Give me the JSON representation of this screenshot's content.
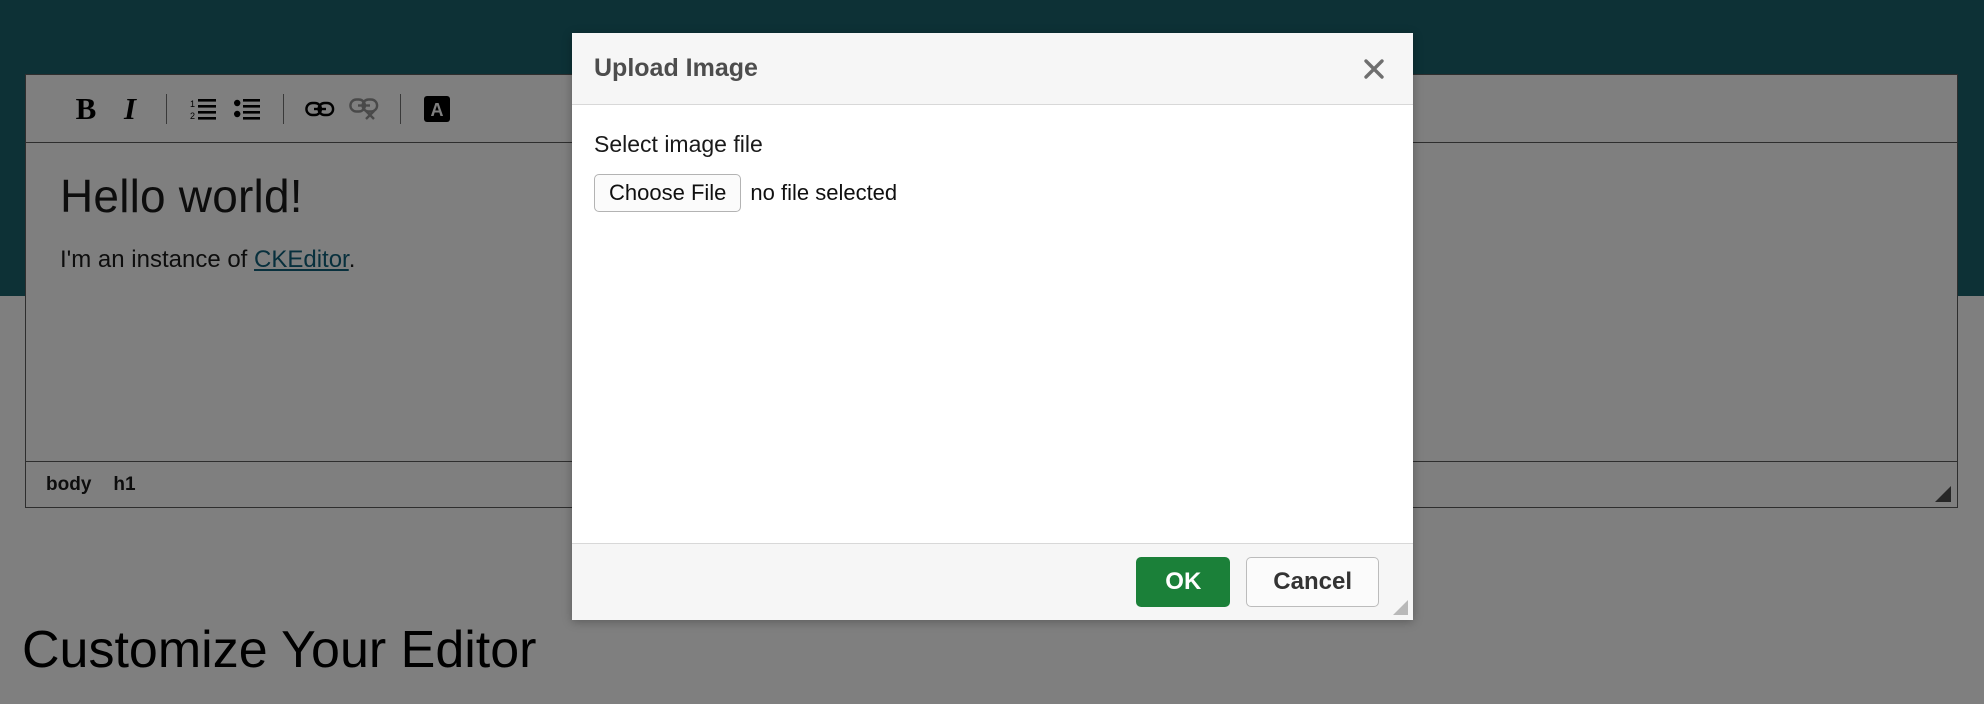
{
  "theme": {
    "hero_band_color": "#1b636c",
    "overlay_color": "rgba(0,0,0,0.5)",
    "ok_button_color": "#1b8039",
    "link_color": "#11617b",
    "dialog_chrome_color": "#f6f6f6"
  },
  "editor": {
    "toolbar": [
      {
        "name": "bold",
        "label": "B",
        "icon": "bold-icon",
        "disabled": false
      },
      {
        "name": "italic",
        "label": "I",
        "icon": "italic-icon",
        "disabled": false
      },
      {
        "name": "separator-1",
        "label": "",
        "icon": "toolbar-separator",
        "disabled": false
      },
      {
        "name": "numbered-list",
        "label": "",
        "icon": "numbered-list-icon",
        "disabled": false
      },
      {
        "name": "bulleted-list",
        "label": "",
        "icon": "bulleted-list-icon",
        "disabled": false
      },
      {
        "name": "separator-2",
        "label": "",
        "icon": "toolbar-separator",
        "disabled": false
      },
      {
        "name": "link",
        "label": "",
        "icon": "link-icon",
        "disabled": false
      },
      {
        "name": "unlink",
        "label": "",
        "icon": "unlink-icon",
        "disabled": true
      },
      {
        "name": "separator-3",
        "label": "",
        "icon": "toolbar-separator",
        "disabled": false
      },
      {
        "name": "anchor",
        "label": "A",
        "icon": "anchor-icon",
        "disabled": false
      }
    ],
    "document": {
      "heading": "Hello world!",
      "paragraph_before_link": "I'm an instance of ",
      "link_text": "CKEditor",
      "paragraph_after_link": "."
    },
    "elements_path": [
      "body",
      "h1"
    ],
    "resize_grip": "resize-grip-icon"
  },
  "page": {
    "section_heading": "Customize Your Editor"
  },
  "dialog": {
    "title": "Upload Image",
    "close_icon": "close-icon",
    "field_label": "Select image file",
    "choose_file_label": "Choose File",
    "file_status": "no file selected",
    "ok_label": "OK",
    "cancel_label": "Cancel",
    "resize_grip": "resize-grip-icon"
  }
}
